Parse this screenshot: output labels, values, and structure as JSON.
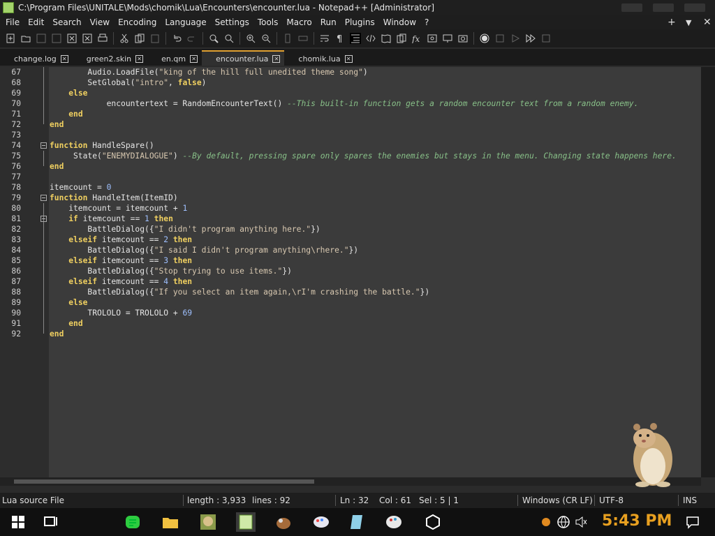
{
  "window": {
    "title": "C:\\Program Files\\UNITALE\\Mods\\chomik\\Lua\\Encounters\\encounter.lua - Notepad++ [Administrator]"
  },
  "menu": [
    "File",
    "Edit",
    "Search",
    "View",
    "Encoding",
    "Language",
    "Settings",
    "Tools",
    "Macro",
    "Run",
    "Plugins",
    "Window",
    "?"
  ],
  "menu_right": {
    "plus": "+",
    "dropdown": "▼",
    "close": "✕"
  },
  "tabs": [
    {
      "label": "change.log",
      "active": false
    },
    {
      "label": "green2.skin",
      "active": false
    },
    {
      "label": "en.qm",
      "active": false
    },
    {
      "label": "encounter.lua",
      "active": true
    },
    {
      "label": "chomik.lua",
      "active": false
    }
  ],
  "code": {
    "lines": [
      {
        "n": "67",
        "fold": "",
        "parts": [
          [
            "",
            "        Audio.LoadFile("
          ],
          [
            "str",
            "\"king of the hill full unedited theme song\""
          ],
          [
            "",
            ")"
          ]
        ]
      },
      {
        "n": "68",
        "fold": "",
        "parts": [
          [
            "",
            "        SetGlobal("
          ],
          [
            "str",
            "\"intro\""
          ],
          [
            "",
            ", "
          ],
          [
            "kw",
            "false"
          ],
          [
            "",
            ")"
          ]
        ]
      },
      {
        "n": "69",
        "fold": "",
        "parts": [
          [
            "",
            "    "
          ],
          [
            "kw",
            "else"
          ]
        ]
      },
      {
        "n": "70",
        "fold": "",
        "parts": [
          [
            "",
            "            encountertext = RandomEncounterText() "
          ],
          [
            "cmt",
            "--This built-in function gets a random encounter text from a random enemy."
          ]
        ]
      },
      {
        "n": "71",
        "fold": "",
        "parts": [
          [
            "",
            "    "
          ],
          [
            "kw",
            "end"
          ]
        ]
      },
      {
        "n": "72",
        "fold": "",
        "parts": [
          [
            "kw",
            "end"
          ]
        ]
      },
      {
        "n": "73",
        "fold": "",
        "parts": [
          [
            "",
            ""
          ]
        ]
      },
      {
        "n": "74",
        "fold": "open",
        "parts": [
          [
            "kw",
            "function"
          ],
          [
            "",
            " HandleSpare()"
          ]
        ]
      },
      {
        "n": "75",
        "fold": "",
        "parts": [
          [
            "",
            "     State("
          ],
          [
            "str",
            "\"ENEMYDIALOGUE\""
          ],
          [
            "",
            ") "
          ],
          [
            "cmt",
            "--By default, pressing spare only spares the enemies but stays in the menu. Changing state happens here."
          ]
        ]
      },
      {
        "n": "76",
        "fold": "",
        "parts": [
          [
            "kw",
            "end"
          ]
        ]
      },
      {
        "n": "77",
        "fold": "",
        "parts": [
          [
            "",
            ""
          ]
        ]
      },
      {
        "n": "78",
        "fold": "",
        "parts": [
          [
            "",
            "itemcount = "
          ],
          [
            "num",
            "0"
          ]
        ]
      },
      {
        "n": "79",
        "fold": "open",
        "parts": [
          [
            "kw",
            "function"
          ],
          [
            "",
            " HandleItem(ItemID)"
          ]
        ]
      },
      {
        "n": "80",
        "fold": "",
        "parts": [
          [
            "",
            "    itemcount = itemcount + "
          ],
          [
            "num",
            "1"
          ]
        ]
      },
      {
        "n": "81",
        "fold": "open",
        "parts": [
          [
            "",
            "    "
          ],
          [
            "kw",
            "if"
          ],
          [
            "",
            " itemcount == "
          ],
          [
            "num",
            "1"
          ],
          [
            "kw",
            " then"
          ]
        ]
      },
      {
        "n": "82",
        "fold": "",
        "parts": [
          [
            "",
            "        BattleDialog({"
          ],
          [
            "str",
            "\"I didn't program anything here.\""
          ],
          [
            "",
            "})"
          ]
        ]
      },
      {
        "n": "83",
        "fold": "",
        "parts": [
          [
            "",
            "    "
          ],
          [
            "kw",
            "elseif"
          ],
          [
            "",
            " itemcount == "
          ],
          [
            "num",
            "2"
          ],
          [
            "kw",
            " then"
          ]
        ]
      },
      {
        "n": "84",
        "fold": "",
        "parts": [
          [
            "",
            "        BattleDialog({"
          ],
          [
            "str",
            "\"I said I didn't program anything\\rhere.\""
          ],
          [
            "",
            "})"
          ]
        ]
      },
      {
        "n": "85",
        "fold": "",
        "parts": [
          [
            "",
            "    "
          ],
          [
            "kw",
            "elseif"
          ],
          [
            "",
            " itemcount == "
          ],
          [
            "num",
            "3"
          ],
          [
            "kw",
            " then"
          ]
        ]
      },
      {
        "n": "86",
        "fold": "",
        "parts": [
          [
            "",
            "        BattleDialog({"
          ],
          [
            "str",
            "\"Stop trying to use items.\""
          ],
          [
            "",
            "})"
          ]
        ]
      },
      {
        "n": "87",
        "fold": "",
        "parts": [
          [
            "",
            "    "
          ],
          [
            "kw",
            "elseif"
          ],
          [
            "",
            " itemcount == "
          ],
          [
            "num",
            "4"
          ],
          [
            "kw",
            " then"
          ]
        ]
      },
      {
        "n": "88",
        "fold": "",
        "parts": [
          [
            "",
            "        BattleDialog({"
          ],
          [
            "str",
            "\"If you select an item again,\\rI'm crashing the battle.\""
          ],
          [
            "",
            "})"
          ]
        ]
      },
      {
        "n": "89",
        "fold": "",
        "parts": [
          [
            "",
            "    "
          ],
          [
            "kw",
            "else"
          ]
        ]
      },
      {
        "n": "90",
        "fold": "",
        "parts": [
          [
            "",
            "        TROLOLO = TROLOLO + "
          ],
          [
            "num",
            "69"
          ]
        ]
      },
      {
        "n": "91",
        "fold": "",
        "parts": [
          [
            "",
            "    "
          ],
          [
            "kw",
            "end"
          ]
        ]
      },
      {
        "n": "92",
        "fold": "",
        "parts": [
          [
            "kw",
            "end"
          ]
        ]
      }
    ]
  },
  "status": {
    "filetype": "Lua source File",
    "length": "length : 3,933",
    "lines": "lines : 92",
    "ln": "Ln : 32",
    "col": "Col : 61",
    "sel": "Sel : 5 | 1",
    "eol": "Windows (CR LF)",
    "encoding": "UTF-8",
    "mode": "INS"
  },
  "taskbar": {
    "clock": "5:43 PM"
  }
}
